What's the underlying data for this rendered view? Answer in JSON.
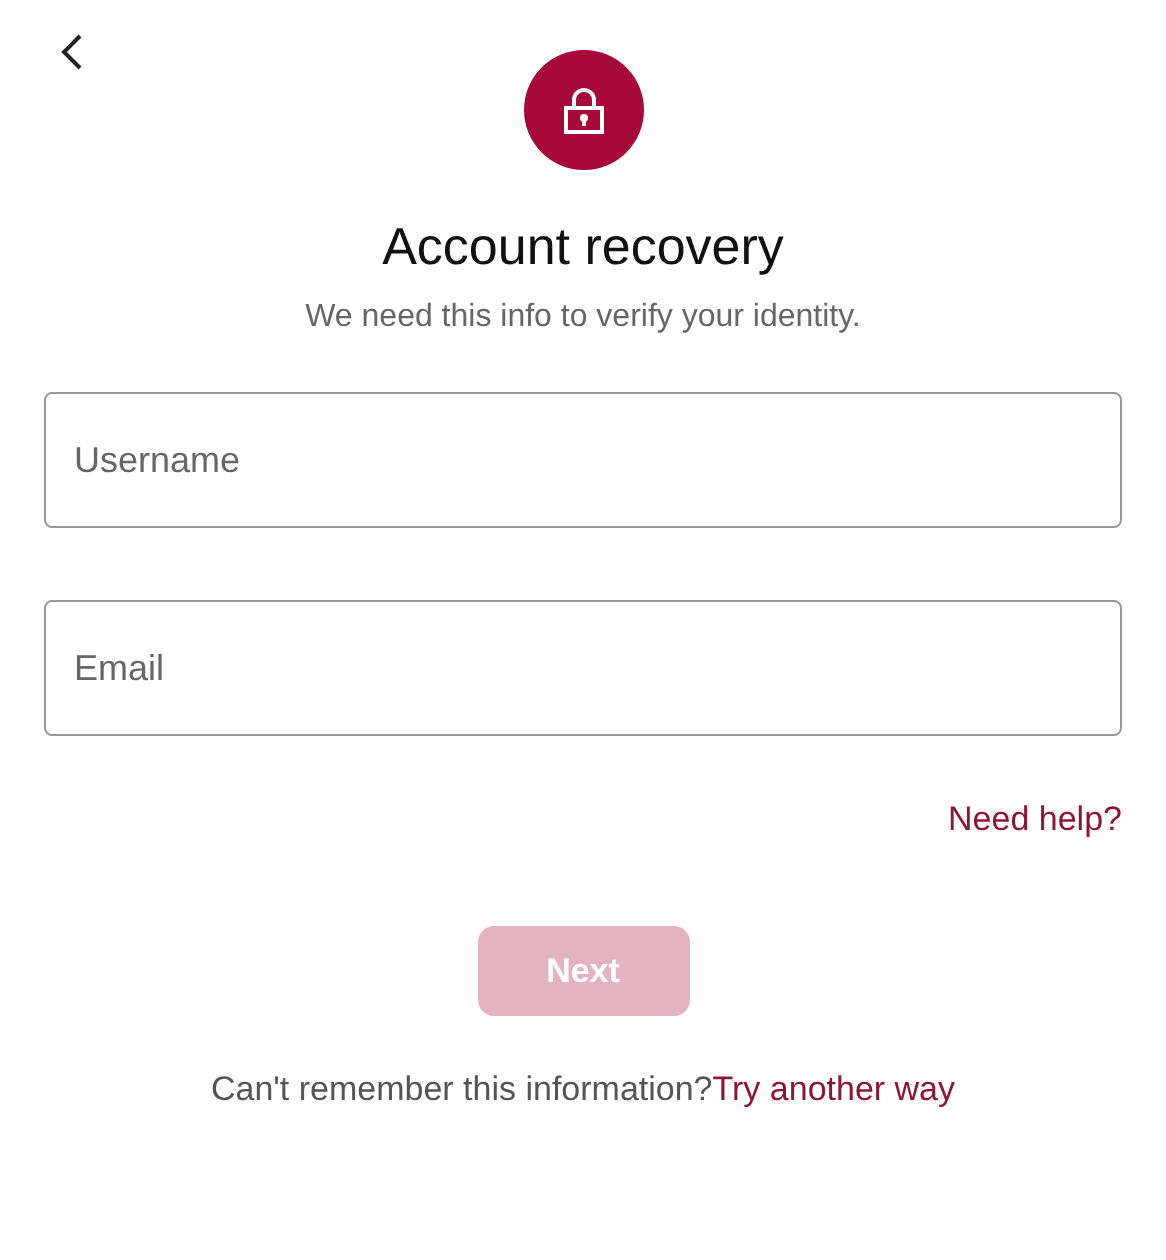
{
  "title": "Account recovery",
  "subtitle": "We need this info to verify your identity.",
  "fields": [
    {
      "placeholder": "Username"
    },
    {
      "placeholder": "Email"
    }
  ],
  "help_link": "Need help?",
  "next_button": {
    "label": "Next",
    "disabled": true
  },
  "footer": {
    "text": "Can't remember this information?",
    "link": "Try another way"
  }
}
